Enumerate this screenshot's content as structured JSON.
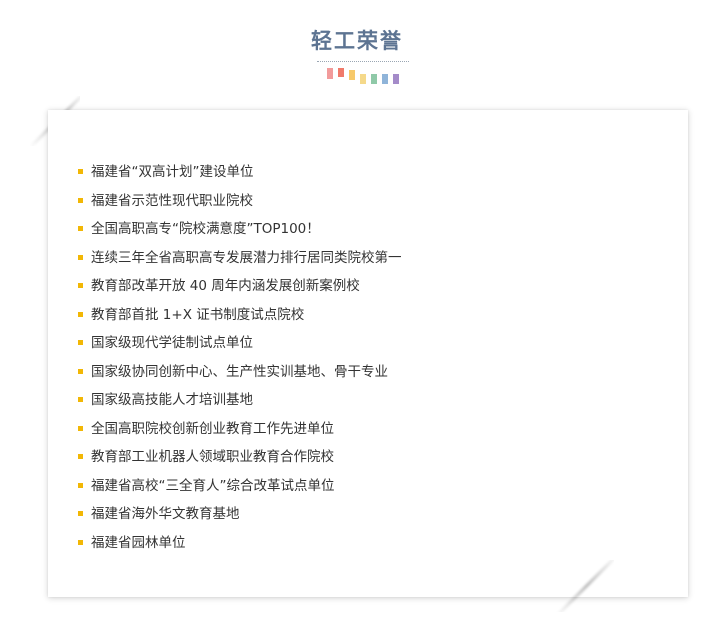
{
  "section": {
    "title": "轻工荣誉"
  },
  "decor": {
    "bar_colors": [
      "#f29b9b",
      "#f07a6a",
      "#f7c96a",
      "#f5d98a",
      "#8fc9a8",
      "#8fb4d9",
      "#a48bc9"
    ]
  },
  "honors": {
    "bullet_color": "#f2b705",
    "items": [
      "福建省“双高计划”建设单位",
      "福建省示范性现代职业院校",
      "全国高职高专“院校满意度”TOP100！",
      "连续三年全省高职高专发展潜力排行居同类院校第一",
      "教育部改革开放 40 周年内涵发展创新案例校",
      "教育部首批 1+X 证书制度试点院校",
      "国家级现代学徒制试点单位",
      "国家级协同创新中心、生产性实训基地、骨干专业",
      "国家级高技能人才培训基地",
      "全国高职院校创新创业教育工作先进单位",
      "教育部工业机器人领域职业教育合作院校",
      "福建省高校“三全育人”综合改革试点单位",
      "福建省海外华文教育基地",
      "福建省园林单位"
    ]
  }
}
